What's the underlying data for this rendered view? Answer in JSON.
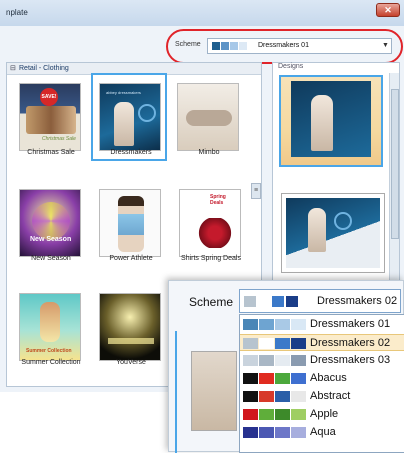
{
  "window": {
    "title": "nplate",
    "close_glyph": "✕"
  },
  "scheme": {
    "label": "Scheme",
    "value": "Dressmakers 01",
    "swatches": [
      "#1f5f8f",
      "#5d93c6",
      "#a7c8e8",
      "#dde9f5"
    ]
  },
  "group": {
    "toggle": "⊟",
    "title": "Retail - Clothing"
  },
  "templates": [
    {
      "caption": "Christmas Sale",
      "selected": false
    },
    {
      "caption": "Dressmakers",
      "selected": true
    },
    {
      "caption": "Mimbo",
      "selected": false
    },
    {
      "caption": "New Season",
      "selected": false
    },
    {
      "caption": "Power Athlete",
      "selected": false
    },
    {
      "caption": "Shirts Spring Deals",
      "selected": false
    },
    {
      "caption": "Summer Collection",
      "selected": false
    },
    {
      "caption": "YouVerse",
      "selected": false
    }
  ],
  "thumbnail_text": {
    "christmas_badge": "SAVE!",
    "christmas_script": "Christmas Sale",
    "new_season": "New Season",
    "spring_deals": "Spring Deals",
    "summer_collection": "Summer Collection",
    "dressmakers_small": "abbey dressmakers"
  },
  "designs_panel": {
    "label": "Designs",
    "splitter_glyph": "≡"
  },
  "callout": {
    "label": "Scheme",
    "selected_value": "Dressmakers 02",
    "selected_swatches": [
      "#b7c4cf",
      "#ffffff",
      "#3b79c9",
      "#1a3d88"
    ],
    "options": [
      {
        "label": "Dressmakers 01",
        "highlighted": false,
        "swatches": [
          "#4a86b7",
          "#6ea4d1",
          "#a9c9e6",
          "#d9e8f5"
        ]
      },
      {
        "label": "Dressmakers 02",
        "highlighted": true,
        "swatches": [
          "#b7c4cf",
          "#ffffff",
          "#3b79c9",
          "#1a3d88"
        ]
      },
      {
        "label": "Dressmakers 03",
        "highlighted": false,
        "swatches": [
          "#c9d3dd",
          "#a9b7c5",
          "#e5ebf1",
          "#8a9bb0"
        ]
      },
      {
        "label": "Abacus",
        "highlighted": false,
        "swatches": [
          "#111111",
          "#e02b20",
          "#4ca83c",
          "#3e6fd0"
        ]
      },
      {
        "label": "Abstract",
        "highlighted": false,
        "swatches": [
          "#111111",
          "#d73a2a",
          "#2b5fa8",
          "#e8e8e8"
        ]
      },
      {
        "label": "Apple",
        "highlighted": false,
        "swatches": [
          "#d1171d",
          "#5fae3a",
          "#3d8a2a",
          "#9fce63"
        ]
      },
      {
        "label": "Aqua",
        "highlighted": false,
        "swatches": [
          "#27318f",
          "#4b58b3",
          "#6d77c8",
          "#a7aede"
        ]
      }
    ]
  },
  "colors": {
    "selection_border": "#4aa6e8",
    "annotation_red": "#e0242a",
    "highlight_row": "#fbeccb"
  }
}
